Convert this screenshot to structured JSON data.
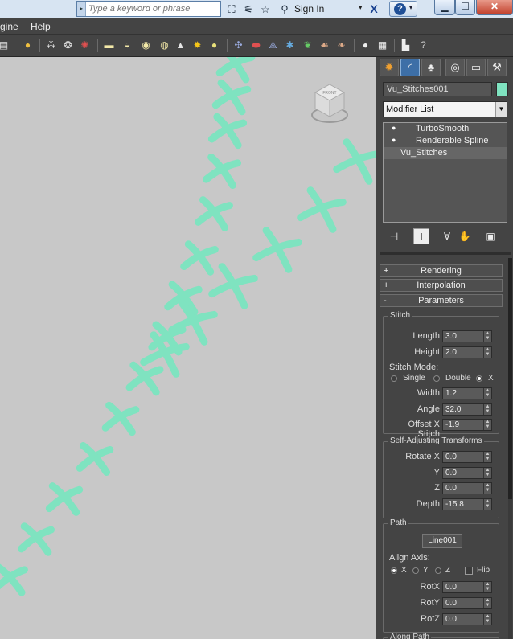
{
  "titlebar": {
    "search": {
      "placeholder": "Type a keyword or phrase"
    },
    "sign_in": "Sign In",
    "icons": [
      "binoculars-icon",
      "satellite-icon",
      "star-icon",
      "user-icon",
      "exchange-icon",
      "help-icon"
    ],
    "window_buttons": {
      "minimize": "▁",
      "maximize": "☐",
      "close": "✕"
    }
  },
  "menu": {
    "items": [
      "gine",
      "Help"
    ]
  },
  "toolbar": {
    "icons": [
      "table-icon",
      "light-bulb-icon",
      "spray-icon",
      "scatter-icon",
      "particle-icon",
      "box-icon",
      "sphere-icon",
      "circle-icon",
      "eye-icon",
      "cone-icon",
      "sun-icon",
      "dot-icon",
      "shuffle-icon",
      "capsule-icon",
      "array-icon",
      "molecule-icon",
      "leaf-icon",
      "dragon-icon",
      "fish-icon",
      "globe-icon",
      "grid-icon",
      "render-icon",
      "help-circle-icon"
    ]
  },
  "viewport": {
    "background": "#c8c8c8",
    "stitch_color": "#7fe3c0",
    "viewcube": {
      "face_text": "FRONT"
    }
  },
  "panel": {
    "tabs": [
      "create-tab",
      "modify-tab",
      "hierarchy-tab",
      "motion-tab",
      "display-tab",
      "utilities-tab"
    ],
    "object_name": "Vu_Stitches001",
    "object_color": "#7fe3c0",
    "modifier_list": "Modifier List",
    "stack": [
      {
        "label": "TurboSmooth",
        "bulb": true
      },
      {
        "label": "Renderable Spline",
        "bulb": true
      },
      {
        "label": "Vu_Stitches",
        "bulb": false,
        "selected": true
      }
    ],
    "rollouts": {
      "rendering": {
        "sign": "+",
        "title": "Rendering"
      },
      "interpolation": {
        "sign": "+",
        "title": "Interpolation"
      },
      "parameters": {
        "sign": "-",
        "title": "Parameters"
      }
    },
    "stitch": {
      "title": "Stitch",
      "length_label": "Length",
      "length": "3.0",
      "height_label": "Height",
      "height": "2.0",
      "mode_label": "Stitch Mode:",
      "mode_single": "Single",
      "mode_double": "Double",
      "mode_x": "X",
      "selected_mode": "X",
      "width_label": "Width",
      "width": "1.2",
      "angle_label": "Angle",
      "angle": "32.0",
      "offset_label": "Offset X Stitch",
      "offset": "-1.9"
    },
    "self_adjusting": {
      "title": "Self-Adjusting Transforms",
      "rotate_x_label": "Rotate X",
      "rotate_x": "0.0",
      "y_label": "Y",
      "y": "0.0",
      "z_label": "Z",
      "z": "0.0",
      "depth_label": "Depth",
      "depth": "-15.8"
    },
    "path": {
      "title": "Path",
      "pick_button": "Line001",
      "align_label": "Align Axis:",
      "axis_x": "X",
      "axis_y": "Y",
      "axis_z": "Z",
      "selected_axis": "X",
      "flip_label": "Flip",
      "rotx_label": "RotX",
      "rotx": "0.0",
      "roty_label": "RotY",
      "roty": "0.0",
      "rotz_label": "RotZ",
      "rotz": "0.0"
    },
    "along_path_title": "Along Path"
  }
}
